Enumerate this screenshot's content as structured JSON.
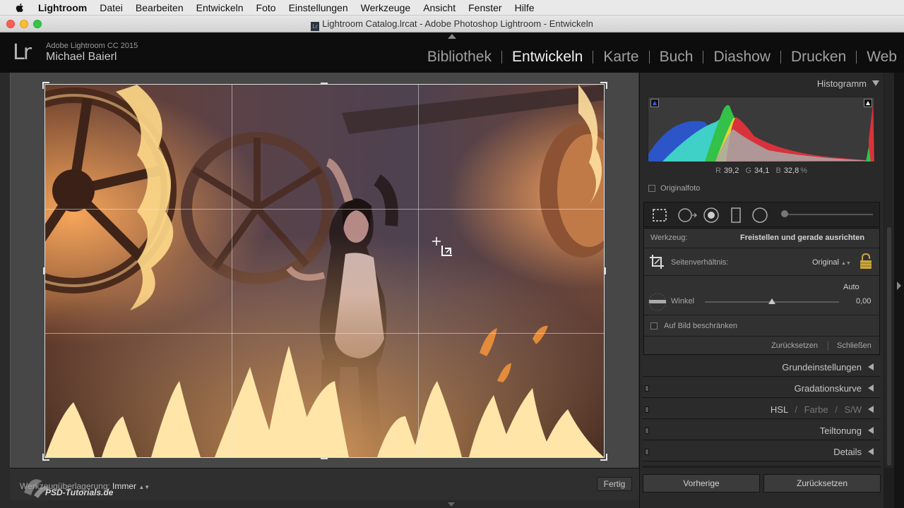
{
  "menubar": {
    "items": [
      "Lightroom",
      "Datei",
      "Bearbeiten",
      "Entwickeln",
      "Foto",
      "Einstellungen",
      "Werkzeuge",
      "Ansicht",
      "Fenster",
      "Hilfe"
    ]
  },
  "window": {
    "title": "Lightroom Catalog.lrcat - Adobe Photoshop Lightroom - Entwickeln",
    "lr_icon": "Lr"
  },
  "identity": {
    "logo": "Lr",
    "app_name": "Adobe Lightroom CC 2015",
    "user_name": "Michael Baierl"
  },
  "modules": {
    "items": [
      "Bibliothek",
      "Entwickeln",
      "Karte",
      "Buch",
      "Diashow",
      "Drucken",
      "Web"
    ],
    "active": "Entwickeln"
  },
  "histogram": {
    "title": "Histogramm",
    "r_label": "R",
    "r_value": "39,2",
    "g_label": "G",
    "g_value": "34,1",
    "b_label": "B",
    "b_value": "32,8",
    "unit": "%",
    "original_label": "Originalfoto"
  },
  "crop": {
    "tool_label": "Werkzeug:",
    "tool_value": "Freistellen und gerade ausrichten",
    "aspect_label": "Seitenverhältnis:",
    "aspect_value": "Original",
    "auto_label": "Auto",
    "angle_label": "Winkel",
    "angle_value": "0,00",
    "angle_position": 0.5,
    "constrain_label": "Auf Bild beschränken",
    "reset_label": "Zurücksetzen",
    "close_label": "Schließen"
  },
  "sections": {
    "basic": "Grundeinstellungen",
    "tone_curve": "Gradationskurve",
    "hsl": "HSL",
    "color": "Farbe",
    "bw": "S/W",
    "slash": "/",
    "split_toning": "Teiltonung",
    "details": "Details"
  },
  "toolbar": {
    "overlay_label": "Werkzeugüberlagerung:",
    "overlay_value": "Immer",
    "done_label": "Fertig",
    "watermark": "PSD-Tutorials.de"
  },
  "bottom": {
    "previous": "Vorherige",
    "reset": "Zurücksetzen"
  },
  "colors": {
    "accent_hist_red": "#d8323a",
    "accent_hist_green": "#33c14a",
    "accent_hist_blue": "#2b55c8",
    "accent_hist_yellow": "#e4d432",
    "accent_hist_cyan": "#3fd0c8"
  }
}
